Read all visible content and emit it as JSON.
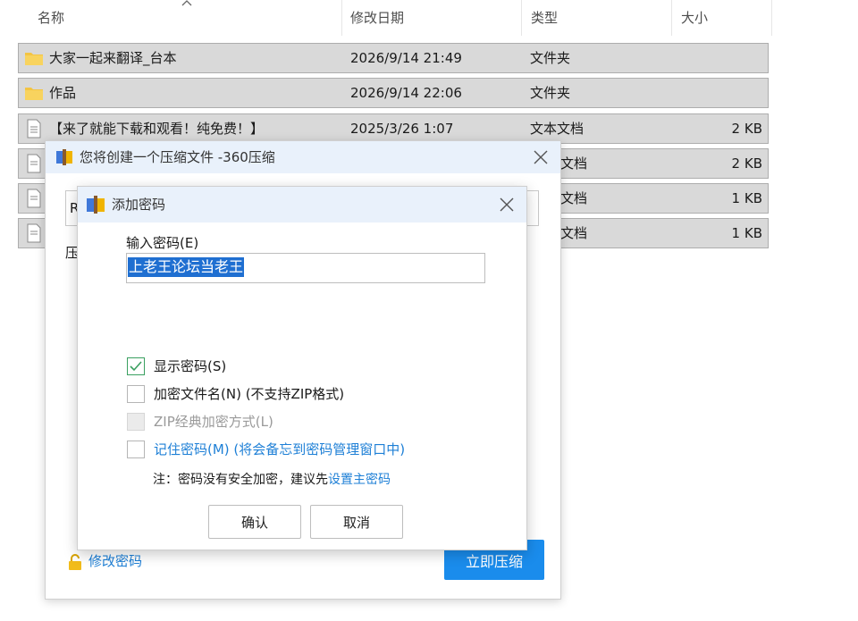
{
  "explorer": {
    "columns": [
      {
        "label": "名称"
      },
      {
        "label": "修改日期"
      },
      {
        "label": "类型"
      },
      {
        "label": "大小"
      }
    ],
    "files": [
      {
        "name": "大家一起来翻译_台本",
        "date": "2026/9/14 21:49",
        "type": "文件夹",
        "size": "",
        "icon": "folder-icon"
      },
      {
        "name": "作品",
        "date": "2026/9/14 22:06",
        "type": "文件夹",
        "size": "",
        "icon": "folder-icon"
      },
      {
        "name": "【来了就能下载和观看！纯免费！】",
        "date": "2025/3/26 1:07",
        "type": "文本文档",
        "size": "2 KB",
        "icon": "text-file-icon"
      },
      {
        "name": "",
        "date": "",
        "type": "文档",
        "size": "2 KB",
        "icon": "text-file-icon"
      },
      {
        "name": "",
        "date": "",
        "type": "文档",
        "size": "1 KB",
        "icon": "text-file-icon"
      },
      {
        "name": "",
        "date": "",
        "type": "文档",
        "size": "1 KB",
        "icon": "text-file-icon"
      }
    ]
  },
  "compress_dialog": {
    "title": "您将创建一个压缩文件 -360压缩",
    "path_value": "R",
    "side_label": "压",
    "change_password_link": "修改密码",
    "compress_button": "立即压缩",
    "accent": "#1a8cec"
  },
  "password_dialog": {
    "title": "添加密码",
    "input_label": "输入密码(E)",
    "password_value": "上老王论坛当老王",
    "options": [
      {
        "label": "显示密码(S)",
        "checked": true,
        "disabled": false
      },
      {
        "label": "加密文件名(N) (不支持ZIP格式)",
        "checked": false,
        "disabled": false
      },
      {
        "label": "ZIP经典加密方式(L)",
        "checked": false,
        "disabled": true
      },
      {
        "label": "记住密码(M) (将会备忘到密码管理窗口中)",
        "checked": false,
        "disabled": false
      }
    ],
    "note_prefix": "注：密码没有安全加密，建议先",
    "note_link": "设置主密码",
    "ok_button": "确认",
    "cancel_button": "取消"
  }
}
